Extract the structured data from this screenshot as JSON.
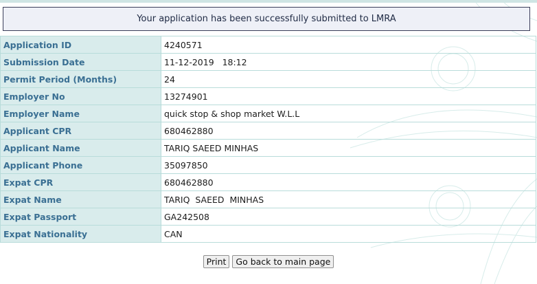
{
  "banner": {
    "message": "Your application has been successfully submitted to LMRA"
  },
  "details": {
    "rows": [
      {
        "label": "Application ID",
        "value": "4240571"
      },
      {
        "label": "Submission Date",
        "value": "11-12-2019   18:12"
      },
      {
        "label": "Permit Period (Months)",
        "value": "24"
      },
      {
        "label": "Employer No",
        "value": "13274901"
      },
      {
        "label": "Employer Name",
        "value": "quick stop & shop market W.L.L"
      },
      {
        "label": "Applicant CPR",
        "value": "680462880"
      },
      {
        "label": "Applicant Name",
        "value": "TARIQ SAEED MINHAS"
      },
      {
        "label": "Applicant Phone",
        "value": "35097850"
      },
      {
        "label": "Expat CPR",
        "value": "680462880"
      },
      {
        "label": "Expat Name",
        "value": "TARIQ  SAEED  MINHAS"
      },
      {
        "label": "Expat Passport",
        "value": "GA242508"
      },
      {
        "label": "Expat Nationality",
        "value": "CAN"
      }
    ]
  },
  "actions": {
    "print_label": "Print",
    "back_label": "Go back to main page"
  },
  "colors": {
    "label_bg": "#d9ecec",
    "label_text": "#3a6f93",
    "border": "#b8dcda",
    "banner_border": "#3a3d59"
  }
}
